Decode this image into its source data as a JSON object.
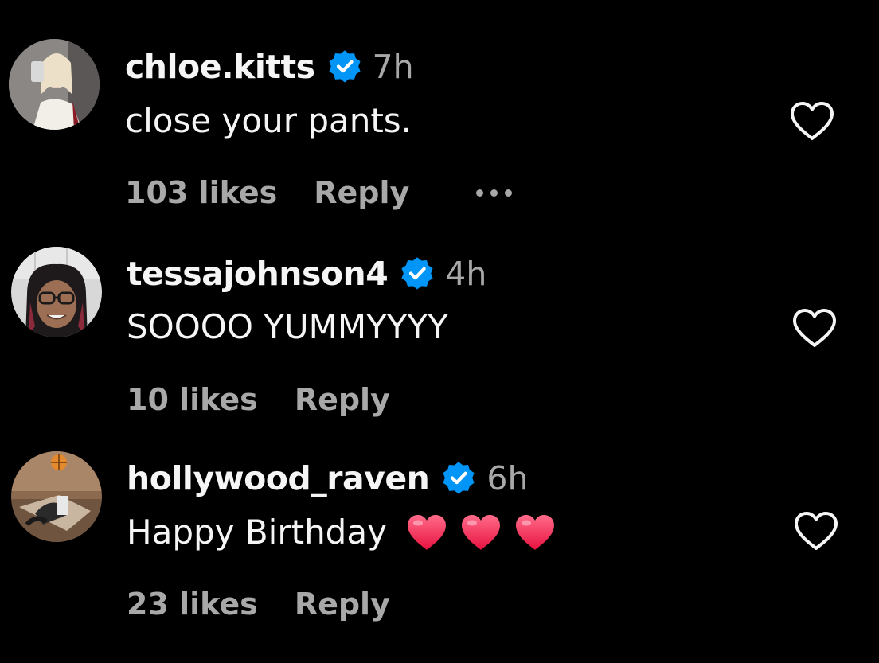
{
  "comments": [
    {
      "username": "chloe.kitts",
      "verified": true,
      "time": "7h",
      "text": "close your pants.",
      "likes": "103 likes",
      "reply": "Reply",
      "has_more_menu": true,
      "hearts": 0
    },
    {
      "username": "tessajohnson4",
      "verified": true,
      "time": "4h",
      "text": "SOOOO YUMMYYYY",
      "likes": "10 likes",
      "reply": "Reply",
      "has_more_menu": false,
      "hearts": 0
    },
    {
      "username": "hollywood_raven",
      "verified": true,
      "time": "6h",
      "text": "Happy Birthday",
      "likes": "23 likes",
      "reply": "Reply",
      "has_more_menu": false,
      "hearts": 3
    }
  ],
  "icons": {
    "verified": "verified-badge-icon",
    "like": "heart-outline-icon",
    "more": "more-options-icon",
    "emoji": "red-heart-emoji"
  },
  "colors": {
    "background": "#000000",
    "primary_text": "#f5f5f5",
    "secondary_text": "#a8a8a8",
    "verified_blue": "#0095f6",
    "emoji_heart": "#f0325a"
  }
}
